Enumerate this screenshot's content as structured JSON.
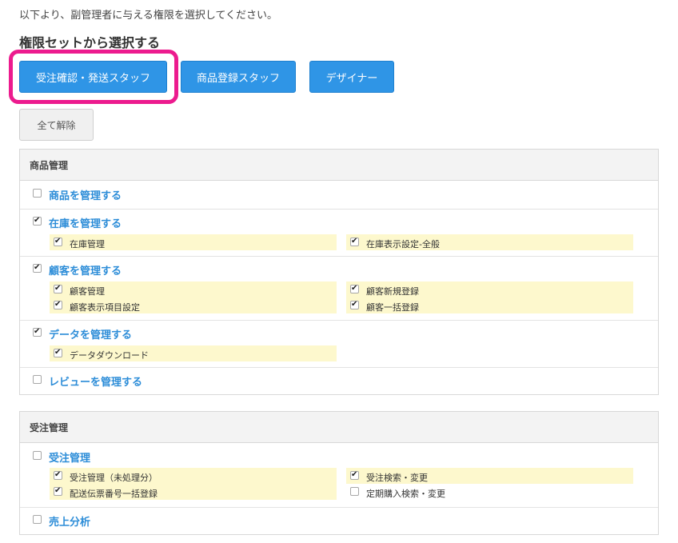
{
  "intro_text": "以下より、副管理者に与える権限を選択してください。",
  "section_title": "権限セットから選択する",
  "presets": [
    {
      "label": "受注確認・発送スタッフ"
    },
    {
      "label": "商品登録スタッフ"
    },
    {
      "label": "デザイナー"
    }
  ],
  "clear_label": "全て解除",
  "panels": [
    {
      "title": "商品管理",
      "groups": [
        {
          "label": "商品を管理する",
          "checked": false,
          "items": []
        },
        {
          "label": "在庫を管理する",
          "checked": true,
          "items": [
            {
              "label": "在庫管理",
              "checked": true
            },
            {
              "label": "在庫表示設定-全般",
              "checked": true
            }
          ]
        },
        {
          "label": "顧客を管理する",
          "checked": true,
          "items": [
            {
              "label": "顧客管理",
              "checked": true
            },
            {
              "label": "顧客新規登録",
              "checked": true
            },
            {
              "label": "顧客表示項目設定",
              "checked": true
            },
            {
              "label": "顧客一括登録",
              "checked": true
            }
          ]
        },
        {
          "label": "データを管理する",
          "checked": true,
          "items": [
            {
              "label": "データダウンロード",
              "checked": true
            }
          ]
        },
        {
          "label": "レビューを管理する",
          "checked": false,
          "items": []
        }
      ]
    },
    {
      "title": "受注管理",
      "groups": [
        {
          "label": "受注管理",
          "checked": false,
          "items": [
            {
              "label": "受注管理（未処理分）",
              "checked": true
            },
            {
              "label": "受注検索・変更",
              "checked": true
            },
            {
              "label": "配送伝票番号一括登録",
              "checked": true
            },
            {
              "label": "定期購入検索・変更",
              "checked": false
            }
          ]
        },
        {
          "label": "売上分析",
          "checked": false,
          "items": []
        }
      ]
    }
  ],
  "colors": {
    "accent": "#2f95e6",
    "link": "#2d8dd8",
    "highlight": "#ec1b8e",
    "sub_bg": "#fdf8cd"
  }
}
